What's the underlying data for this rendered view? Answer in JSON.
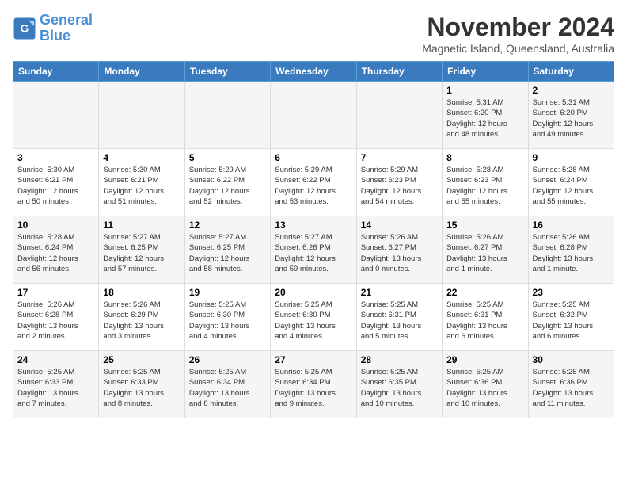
{
  "logo": {
    "line1": "General",
    "line2": "Blue"
  },
  "title": "November 2024",
  "location": "Magnetic Island, Queensland, Australia",
  "weekdays": [
    "Sunday",
    "Monday",
    "Tuesday",
    "Wednesday",
    "Thursday",
    "Friday",
    "Saturday"
  ],
  "weeks": [
    [
      {
        "day": "",
        "info": ""
      },
      {
        "day": "",
        "info": ""
      },
      {
        "day": "",
        "info": ""
      },
      {
        "day": "",
        "info": ""
      },
      {
        "day": "",
        "info": ""
      },
      {
        "day": "1",
        "info": "Sunrise: 5:31 AM\nSunset: 6:20 PM\nDaylight: 12 hours\nand 48 minutes."
      },
      {
        "day": "2",
        "info": "Sunrise: 5:31 AM\nSunset: 6:20 PM\nDaylight: 12 hours\nand 49 minutes."
      }
    ],
    [
      {
        "day": "3",
        "info": "Sunrise: 5:30 AM\nSunset: 6:21 PM\nDaylight: 12 hours\nand 50 minutes."
      },
      {
        "day": "4",
        "info": "Sunrise: 5:30 AM\nSunset: 6:21 PM\nDaylight: 12 hours\nand 51 minutes."
      },
      {
        "day": "5",
        "info": "Sunrise: 5:29 AM\nSunset: 6:22 PM\nDaylight: 12 hours\nand 52 minutes."
      },
      {
        "day": "6",
        "info": "Sunrise: 5:29 AM\nSunset: 6:22 PM\nDaylight: 12 hours\nand 53 minutes."
      },
      {
        "day": "7",
        "info": "Sunrise: 5:29 AM\nSunset: 6:23 PM\nDaylight: 12 hours\nand 54 minutes."
      },
      {
        "day": "8",
        "info": "Sunrise: 5:28 AM\nSunset: 6:23 PM\nDaylight: 12 hours\nand 55 minutes."
      },
      {
        "day": "9",
        "info": "Sunrise: 5:28 AM\nSunset: 6:24 PM\nDaylight: 12 hours\nand 55 minutes."
      }
    ],
    [
      {
        "day": "10",
        "info": "Sunrise: 5:28 AM\nSunset: 6:24 PM\nDaylight: 12 hours\nand 56 minutes."
      },
      {
        "day": "11",
        "info": "Sunrise: 5:27 AM\nSunset: 6:25 PM\nDaylight: 12 hours\nand 57 minutes."
      },
      {
        "day": "12",
        "info": "Sunrise: 5:27 AM\nSunset: 6:25 PM\nDaylight: 12 hours\nand 58 minutes."
      },
      {
        "day": "13",
        "info": "Sunrise: 5:27 AM\nSunset: 6:26 PM\nDaylight: 12 hours\nand 59 minutes."
      },
      {
        "day": "14",
        "info": "Sunrise: 5:26 AM\nSunset: 6:27 PM\nDaylight: 13 hours\nand 0 minutes."
      },
      {
        "day": "15",
        "info": "Sunrise: 5:26 AM\nSunset: 6:27 PM\nDaylight: 13 hours\nand 1 minute."
      },
      {
        "day": "16",
        "info": "Sunrise: 5:26 AM\nSunset: 6:28 PM\nDaylight: 13 hours\nand 1 minute."
      }
    ],
    [
      {
        "day": "17",
        "info": "Sunrise: 5:26 AM\nSunset: 6:28 PM\nDaylight: 13 hours\nand 2 minutes."
      },
      {
        "day": "18",
        "info": "Sunrise: 5:26 AM\nSunset: 6:29 PM\nDaylight: 13 hours\nand 3 minutes."
      },
      {
        "day": "19",
        "info": "Sunrise: 5:25 AM\nSunset: 6:30 PM\nDaylight: 13 hours\nand 4 minutes."
      },
      {
        "day": "20",
        "info": "Sunrise: 5:25 AM\nSunset: 6:30 PM\nDaylight: 13 hours\nand 4 minutes."
      },
      {
        "day": "21",
        "info": "Sunrise: 5:25 AM\nSunset: 6:31 PM\nDaylight: 13 hours\nand 5 minutes."
      },
      {
        "day": "22",
        "info": "Sunrise: 5:25 AM\nSunset: 6:31 PM\nDaylight: 13 hours\nand 6 minutes."
      },
      {
        "day": "23",
        "info": "Sunrise: 5:25 AM\nSunset: 6:32 PM\nDaylight: 13 hours\nand 6 minutes."
      }
    ],
    [
      {
        "day": "24",
        "info": "Sunrise: 5:25 AM\nSunset: 6:33 PM\nDaylight: 13 hours\nand 7 minutes."
      },
      {
        "day": "25",
        "info": "Sunrise: 5:25 AM\nSunset: 6:33 PM\nDaylight: 13 hours\nand 8 minutes."
      },
      {
        "day": "26",
        "info": "Sunrise: 5:25 AM\nSunset: 6:34 PM\nDaylight: 13 hours\nand 8 minutes."
      },
      {
        "day": "27",
        "info": "Sunrise: 5:25 AM\nSunset: 6:34 PM\nDaylight: 13 hours\nand 9 minutes."
      },
      {
        "day": "28",
        "info": "Sunrise: 5:25 AM\nSunset: 6:35 PM\nDaylight: 13 hours\nand 10 minutes."
      },
      {
        "day": "29",
        "info": "Sunrise: 5:25 AM\nSunset: 6:36 PM\nDaylight: 13 hours\nand 10 minutes."
      },
      {
        "day": "30",
        "info": "Sunrise: 5:25 AM\nSunset: 6:36 PM\nDaylight: 13 hours\nand 11 minutes."
      }
    ]
  ]
}
